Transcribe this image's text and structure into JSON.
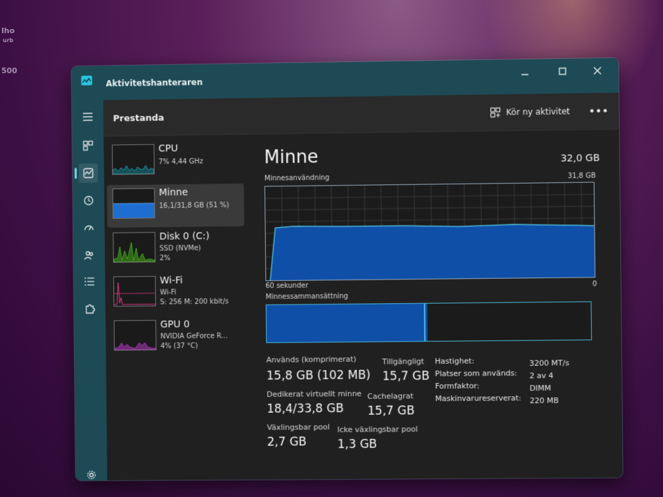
{
  "background": {
    "text_fragments": [
      "lho",
      "urb",
      "500",
      "urb"
    ]
  },
  "window": {
    "title": "Aktivitetshanteraren",
    "controls": {
      "minimize": "—",
      "maximize": "☐",
      "close": "✕"
    }
  },
  "header": {
    "page_title": "Prestanda",
    "run_task_label": "Kör ny aktivitet",
    "more_label": "•••"
  },
  "perf_items": [
    {
      "name": "CPU",
      "sub1": "7% 4,44 GHz",
      "sub2": "",
      "sub3": "",
      "color": "#17b3c9"
    },
    {
      "name": "Minne",
      "sub1": "16,1/31,8 GB (51 %)",
      "sub2": "",
      "sub3": "",
      "color": "#1e6ed2"
    },
    {
      "name": "Disk 0 (C:)",
      "sub1": "SSD (NVMe)",
      "sub2": "2%",
      "sub3": "",
      "color": "#4cc31b"
    },
    {
      "name": "Wi-Fi",
      "sub1": "Wi-Fi",
      "sub2": "S: 256 M: 200 kbit/s",
      "sub3": "",
      "color": "#e0398c"
    },
    {
      "name": "GPU 0",
      "sub1": "NVIDIA GeForce R...",
      "sub2": "4% (37 °C)",
      "sub3": "",
      "color": "#c23bd2"
    }
  ],
  "memory": {
    "title": "Minne",
    "total": "32,0 GB",
    "usage_label": "Minnesanvändning",
    "usage_max": "31,8 GB",
    "time_left": "60 sekunder",
    "time_right": "0",
    "composition_label": "Minnessammansättning",
    "used_fraction": 0.51,
    "stats": {
      "used_label": "Används (komprimerat)",
      "used_value": "15,8 GB (102 MB)",
      "available_label": "Tillgängligt",
      "available_value": "15,7 GB",
      "committed_label": "Dedikerat virtuellt minne",
      "committed_value": "18,4/33,8 GB",
      "cached_label": "Cachelagrat",
      "cached_value": "15,7 GB",
      "paged_label": "Växlingsbar pool",
      "paged_value": "2,7 GB",
      "nonpaged_label": "Icke växlingsbar pool",
      "nonpaged_value": "1,3 GB"
    },
    "specs": [
      {
        "label": "Hastighet:",
        "value": "3200 MT/s"
      },
      {
        "label": "Platser som används:",
        "value": "2 av 4"
      },
      {
        "label": "Formfaktor:",
        "value": "DIMM"
      },
      {
        "label": "Maskinvarureserverat:",
        "value": "220 MB"
      }
    ]
  },
  "colors": {
    "accent": "#1d4a55",
    "memory_fill": "#0f4fa8",
    "memory_line": "#4db8d8"
  }
}
